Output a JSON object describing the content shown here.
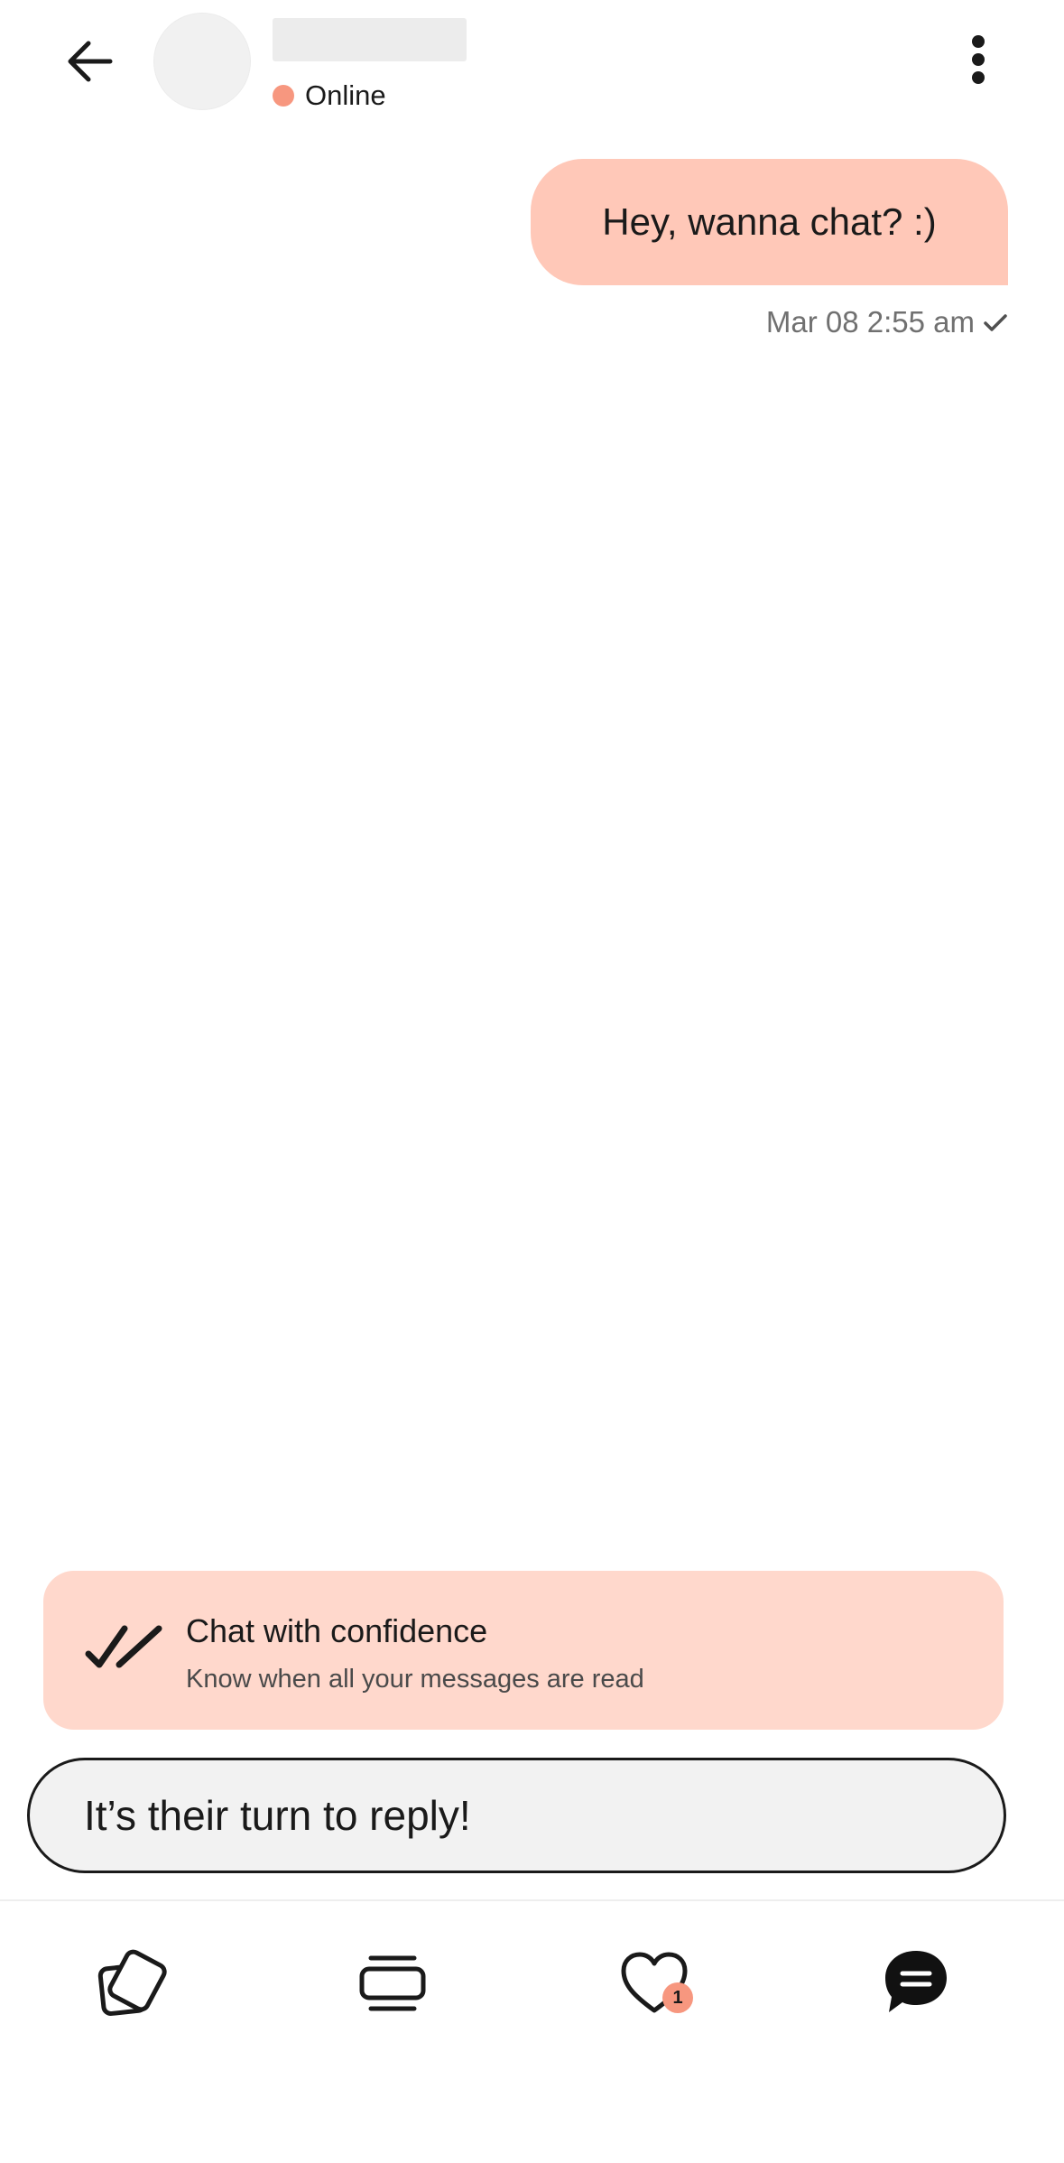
{
  "colors": {
    "accent": "#ffc8b8",
    "promo_bg": "#ffd8cc",
    "status_dot": "#f7977f",
    "badge": "#f7977f"
  },
  "header": {
    "back_icon": "arrow-left-icon",
    "status_text": "Online",
    "more_icon": "more-vertical-icon"
  },
  "messages": [
    {
      "text": "Hey, wanna chat? :)",
      "timestamp": "Mar 08 2:55 am",
      "status_icon": "check-icon"
    }
  ],
  "promo": {
    "icon": "double-check-icon",
    "title": "Chat with confidence",
    "subtitle": "Know when all your messages are read"
  },
  "reply": {
    "text": "It’s their turn to reply!"
  },
  "nav": {
    "items": [
      {
        "icon": "cards-icon"
      },
      {
        "icon": "stack-icon"
      },
      {
        "icon": "heart-icon",
        "badge": "1"
      },
      {
        "icon": "chat-icon"
      }
    ]
  }
}
